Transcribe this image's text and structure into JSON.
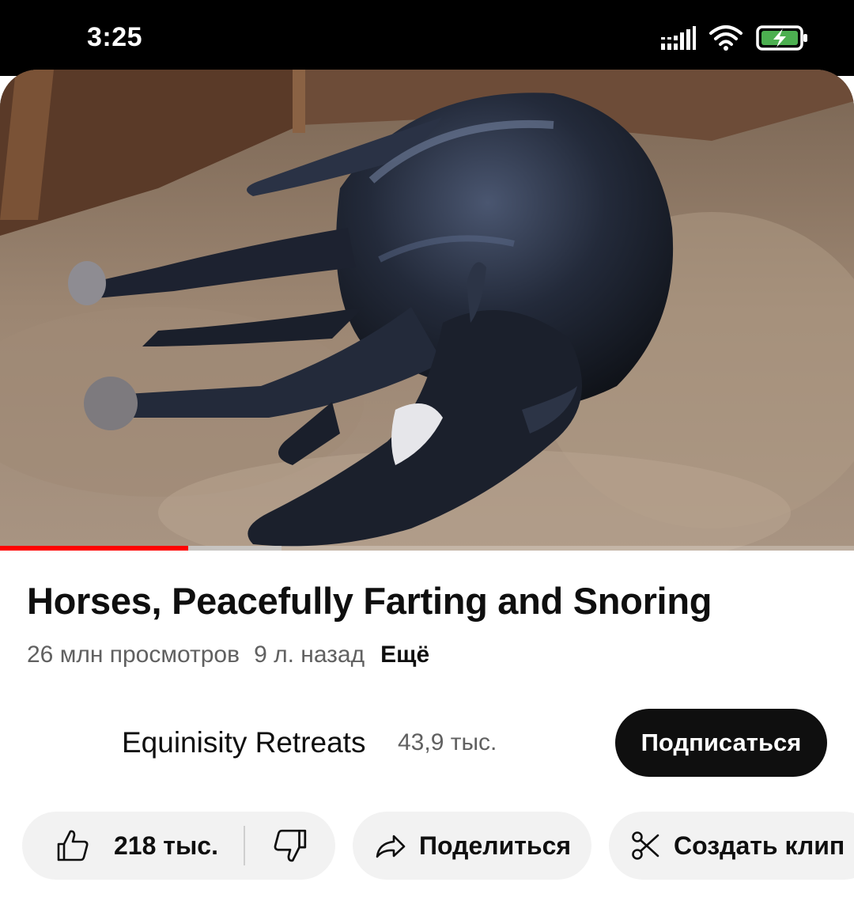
{
  "status_bar": {
    "time": "3:25",
    "icons": [
      "signal-icon",
      "wifi-icon",
      "battery-charging-icon"
    ],
    "battery_color": "#4caf50"
  },
  "video": {
    "thumbnail": "horse-lying-in-stall-image",
    "progress_played_fraction": 0.22,
    "progress_buffered_fraction": 0.33,
    "progress_color": "#ff0000"
  },
  "info": {
    "title": "Horses, Peacefully Farting and Snoring",
    "views": "26 млн просмотров",
    "age": "9 л. назад",
    "more_label": "Ещё"
  },
  "channel": {
    "name": "Equinisity Retreats",
    "subscribers": "43,9 тыс.",
    "subscribe_label": "Подписаться"
  },
  "actions": {
    "like_count": "218 тыс.",
    "like_icon": "thumbs-up-icon",
    "dislike_icon": "thumbs-down-icon",
    "share_label": "Поделиться",
    "share_icon": "share-arrow-icon",
    "clip_label": "Создать клип",
    "clip_icon": "scissors-icon"
  }
}
